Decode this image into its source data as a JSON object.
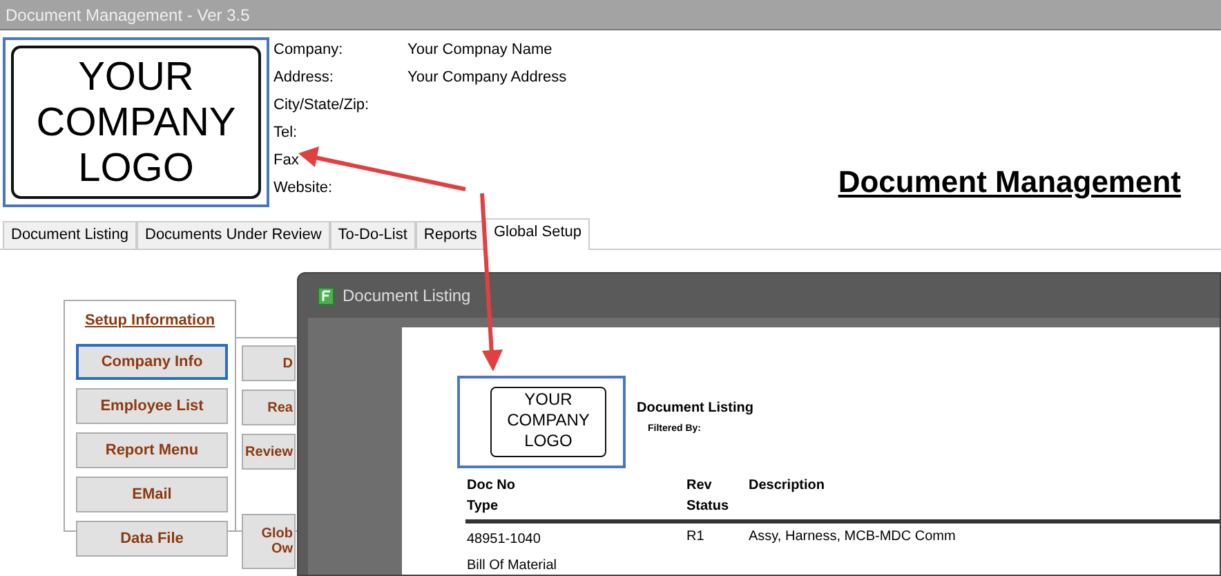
{
  "window": {
    "title": "Document Management - Ver 3.5"
  },
  "header": {
    "logo_lines": [
      "YOUR",
      "COMPANY",
      "LOGO"
    ],
    "fields": [
      {
        "label": "Company:",
        "value": "Your Compnay Name"
      },
      {
        "label": "Address:",
        "value": "Your Company Address"
      },
      {
        "label": "City/State/Zip:"
      },
      {
        "label": "Tel:"
      },
      {
        "label": "Fax"
      },
      {
        "label": "Website:"
      }
    ],
    "title": "Document Management"
  },
  "tabs": [
    {
      "label": "Document Listing",
      "selected": false
    },
    {
      "label": "Documents Under Review",
      "selected": false
    },
    {
      "label": "To-Do-List",
      "selected": false
    },
    {
      "label": "Reports",
      "selected": false
    },
    {
      "label": "Global Setup",
      "selected": true
    }
  ],
  "setup": {
    "heading": "Setup Information",
    "buttons_left": [
      {
        "label": "Company Info",
        "focused": true
      },
      {
        "label": "Employee List",
        "focused": false
      },
      {
        "label": "Report Menu",
        "focused": false
      },
      {
        "label": "EMail",
        "focused": false
      },
      {
        "label": "Data File",
        "focused": false
      }
    ],
    "buttons_right": [
      {
        "label": "D"
      },
      {
        "label": "Rea"
      },
      {
        "label": "Review"
      },
      {
        "label": "Glob Ow"
      }
    ]
  },
  "report_window": {
    "title": "Document Listing",
    "logo_lines": [
      "YOUR",
      "COMPANY",
      "LOGO"
    ],
    "report_title": "Document Listing",
    "filter_label": "Filtered By:",
    "columns": [
      {
        "lines": [
          "Doc No",
          "Type"
        ]
      },
      {
        "lines": [
          "Rev",
          "Status"
        ]
      },
      {
        "lines": [
          "Description"
        ]
      }
    ],
    "rows": [
      {
        "cells": [
          [
            "48951-1040",
            "Bill Of Material"
          ],
          [
            "R1"
          ],
          [
            "Assy, Harness, MCB-MDC Comm"
          ]
        ]
      }
    ]
  }
}
